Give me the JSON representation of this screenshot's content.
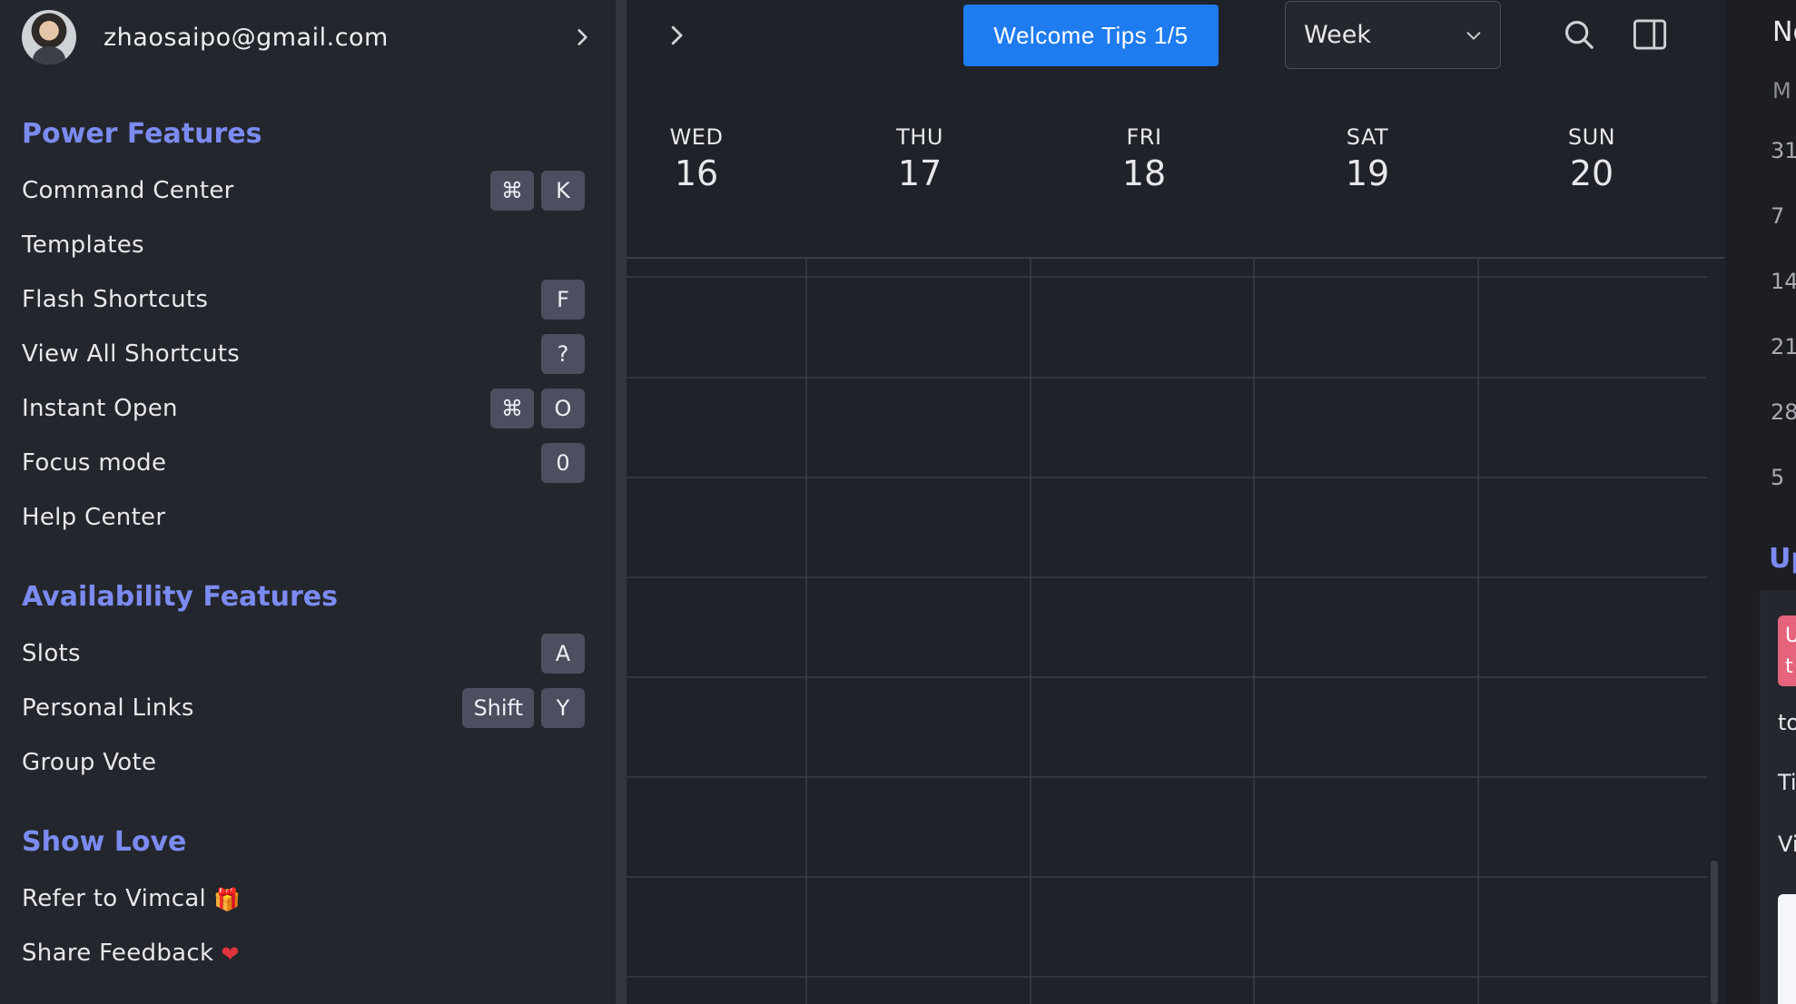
{
  "account": {
    "email": "zhaosaipo@gmail.com"
  },
  "sidebar": {
    "sections": [
      {
        "title": "Power Features"
      },
      {
        "title": "Availability Features"
      },
      {
        "title": "Show Love"
      }
    ],
    "power_items": [
      {
        "label": "Command Center",
        "keys": [
          "⌘",
          "K"
        ]
      },
      {
        "label": "Templates",
        "keys": []
      },
      {
        "label": "Flash Shortcuts",
        "keys": [
          "F"
        ]
      },
      {
        "label": "View All Shortcuts",
        "keys": [
          "?"
        ]
      },
      {
        "label": "Instant Open",
        "keys": [
          "⌘",
          "O"
        ]
      },
      {
        "label": "Focus mode",
        "keys": [
          "0"
        ]
      },
      {
        "label": "Help Center",
        "keys": []
      }
    ],
    "availability_items": [
      {
        "label": "Slots",
        "keys": [
          "A"
        ]
      },
      {
        "label": "Personal Links",
        "keys": [
          "Shift",
          "Y"
        ]
      },
      {
        "label": "Group Vote",
        "keys": []
      }
    ],
    "love_items": [
      {
        "label": "Refer to Vimcal",
        "emoji": "🎁",
        "icon": "gift-icon"
      },
      {
        "label": "Share Feedback",
        "emoji": "❤",
        "icon": "heart-icon"
      }
    ]
  },
  "toolbar": {
    "welcome_label": "Welcome Tips 1/5",
    "view_value": "Week",
    "accent": "#1f7cf0"
  },
  "week": {
    "days": [
      {
        "dow": "WED",
        "num": "16"
      },
      {
        "dow": "THU",
        "num": "17"
      },
      {
        "dow": "FRI",
        "num": "18"
      },
      {
        "dow": "SAT",
        "num": "19"
      },
      {
        "dow": "SUN",
        "num": "20"
      }
    ]
  },
  "right_panel": {
    "month_partial": "No",
    "dow_partial": "M",
    "week_starts": [
      "31",
      "7",
      "14",
      "21",
      "28",
      "5"
    ],
    "upcoming_partial": "Up",
    "badge_partial": [
      "U",
      "t"
    ],
    "text_partials": [
      "to",
      "Ti",
      "Vi"
    ]
  }
}
